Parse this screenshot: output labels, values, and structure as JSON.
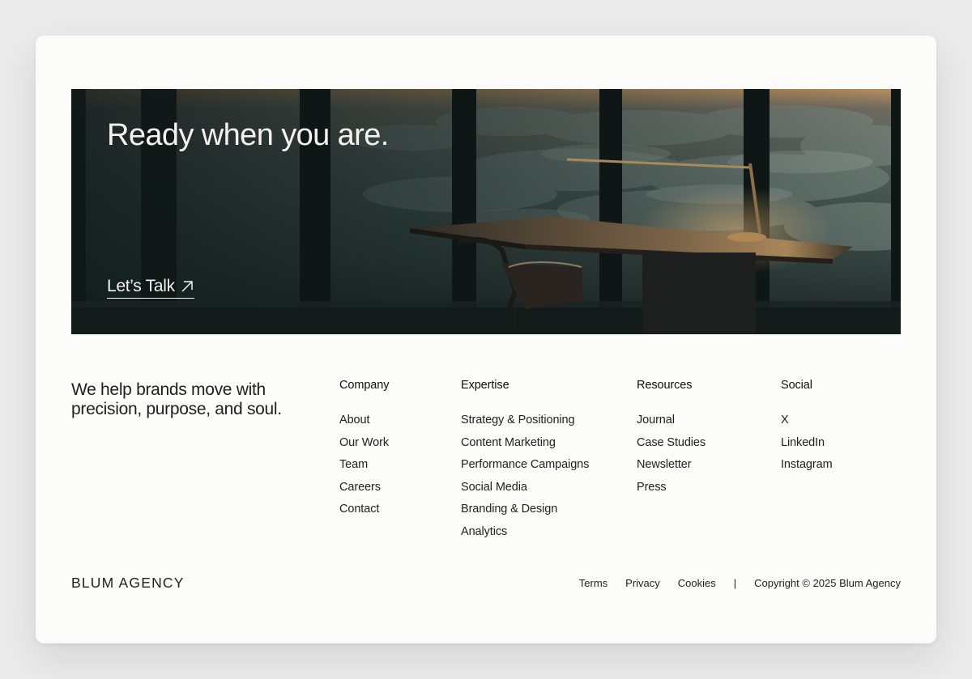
{
  "hero": {
    "title": "Ready when you are.",
    "cta_label": "Let’s Talk",
    "cta_icon": "arrow-up-right-icon"
  },
  "footer": {
    "tagline": "We help brands move with precision, purpose, and soul.",
    "columns": [
      {
        "heading": "Company",
        "items": [
          "About",
          "Our Work",
          "Team",
          "Careers",
          "Contact"
        ]
      },
      {
        "heading": "Expertise",
        "items": [
          "Strategy & Positioning",
          "Content Marketing",
          "Performance Campaigns",
          "Social Media",
          "Branding & Design",
          "Analytics"
        ]
      },
      {
        "heading": "Resources",
        "items": [
          "Journal",
          "Case Studies",
          "Newsletter",
          "Press"
        ]
      },
      {
        "heading": "Social",
        "items": [
          "X",
          "LinkedIn",
          "Instagram"
        ]
      }
    ],
    "brand": "BLUM AGENCY",
    "legal": {
      "terms": "Terms",
      "privacy": "Privacy",
      "cookies": "Cookies",
      "separator": "|",
      "copyright": "Copyright © 2025 Blum Agency"
    }
  },
  "colors": {
    "page_background": "#ebebeb",
    "card_background": "#fbfbfa",
    "text": "#1c1c1c",
    "hero_text": "#f4f2ee"
  }
}
